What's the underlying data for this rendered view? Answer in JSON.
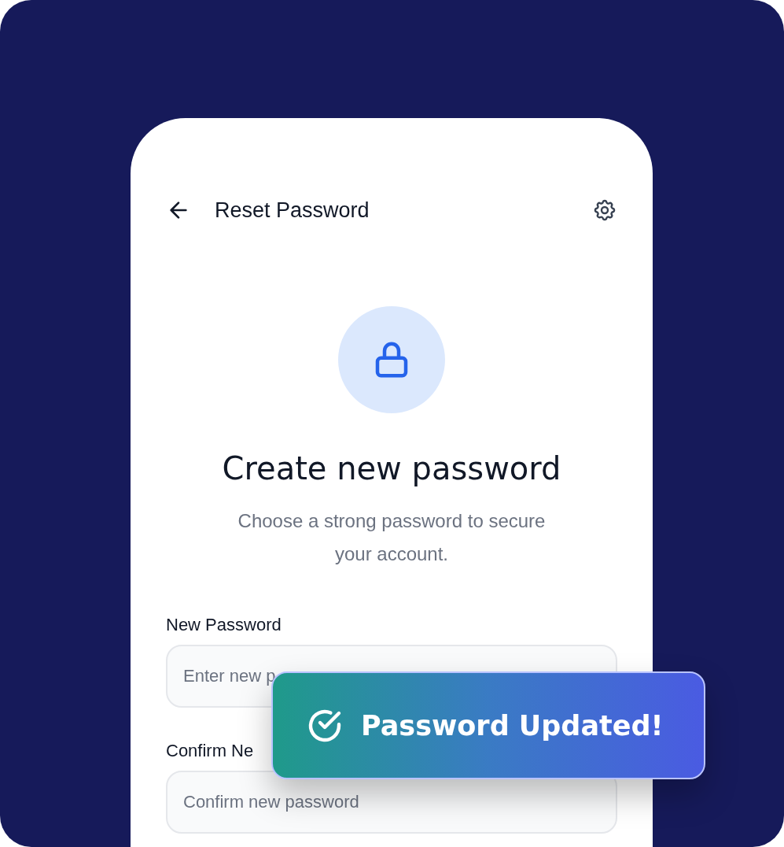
{
  "header": {
    "title": "Reset Password"
  },
  "heading": "Create new password",
  "subtitle": "Choose a strong password to secure your account.",
  "fields": [
    {
      "label": "New Password",
      "placeholder": "Enter new p"
    },
    {
      "label": "Confirm Ne",
      "placeholder": "Confirm new password"
    }
  ],
  "toast": {
    "message": "Password Updated!"
  }
}
